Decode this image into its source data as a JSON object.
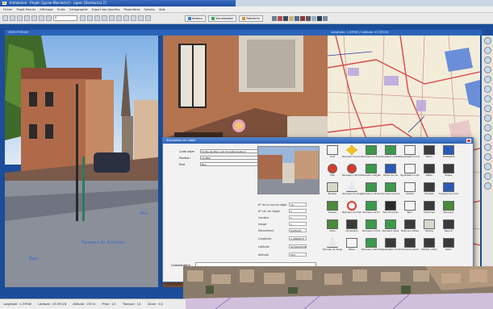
{
  "window": {
    "title": "Immersion - Projet: [Lycee Marrier(s)] - Ligne: [Secteur(s) 2]"
  },
  "menu": [
    "Fichier",
    "Projet Marrier",
    "Affichage",
    "Outils",
    "Cartographie",
    "Export des données",
    "Paramètres",
    "Options",
    "Aide"
  ],
  "toolbar": {
    "field_value": "0",
    "buttons": [
      {
        "label": "Aidesur",
        "icon": "help-icon"
      },
      {
        "label": "Visualisation",
        "icon": "eye-icon"
      },
      {
        "label": "Rafraîchir",
        "icon": "refresh-icon"
      }
    ]
  },
  "panes": {
    "left_title": "VIDÉOTHÈQUE",
    "map_title": "Longitude: 1.3994E / Latitude: 43.5911N"
  },
  "street_labels": [
    "Mur",
    "Panneau de direction",
    "Baie"
  ],
  "status": [
    "Longitude : 1.3994E",
    "Latitude : 43.5911N",
    "Altitude : 153 m",
    "Prise : 1/1",
    "Tranque : 1/1",
    "Zoom : 1/1"
  ],
  "dialog": {
    "title": "Acquisition de l'objet",
    "fields": [
      {
        "label": "Code objet",
        "value": "Sortie de Marc cell (Immatriculation)"
      },
      {
        "label": "Position",
        "value": "15.856"
      },
      {
        "label": "Etat",
        "value": "Bon"
      }
    ],
    "properties": [
      {
        "label": "N° de la couche objet",
        "value": "15"
      },
      {
        "label": "N° réf. de l'objet",
        "value": "1"
      },
      {
        "label": "Caméra",
        "value": "1"
      },
      {
        "label": "Image",
        "value": "1"
      },
      {
        "label": "Mouvement",
        "value": "2325125"
      },
      {
        "label": "Longitude",
        "value": "1.399432 E"
      },
      {
        "label": "Latitude",
        "value": "43.591134 N"
      },
      {
        "label": "Altitude",
        "value": "153"
      }
    ],
    "footer_label": "Commentaire",
    "signs": [
      {
        "label": "Arrêt",
        "icon": "white-sign-icon"
      },
      {
        "label": "Panneaux de priorité",
        "icon": "priority-sign-icon"
      },
      {
        "label": "Panneaux de direction",
        "icon": "green-direction-sign-icon"
      },
      {
        "label": "Panneaux localisation",
        "icon": "green-direction-sign-icon"
      },
      {
        "label": "Signalisation horizontale",
        "icon": "white-sign-icon"
      },
      {
        "label": "Borne",
        "icon": "dark-sign-icon"
      },
      {
        "label": "Candélabre",
        "icon": "bus-sign-icon"
      },
      {
        "label": "Stop",
        "icon": "stop-sign-icon"
      },
      {
        "label": "Panneaux interdiction",
        "icon": "no-entry-sign-icon"
      },
      {
        "label": "Panneaux obligation",
        "icon": "green-direction-sign-icon"
      },
      {
        "label": "Plaque de rue",
        "icon": "blue-sign-icon"
      },
      {
        "label": "Signalisation lumineuse",
        "icon": "white-sign-icon"
      },
      {
        "label": "Balise",
        "icon": "dark-sign-icon"
      },
      {
        "label": "Poteau",
        "icon": "dark-sign-icon"
      },
      {
        "label": "Bouleau",
        "icon": "light-sign-icon"
      },
      {
        "label": "Panneaux de danger",
        "icon": "warning-sign-icon"
      },
      {
        "label": "Panneaux indication",
        "icon": "green-direction-sign-icon"
      },
      {
        "label": "Panneaux service",
        "icon": "green-direction-sign-icon"
      },
      {
        "label": "Caméra",
        "icon": "white-sign-icon"
      },
      {
        "label": "Poubelle",
        "icon": "dark-sign-icon"
      },
      {
        "label": "Transport en commun",
        "icon": "bus-sign-icon"
      },
      {
        "label": "Flaques",
        "icon": "green-sign-icon"
      },
      {
        "label": "Panneaux de limitation",
        "icon": "speed-sign-icon"
      },
      {
        "label": "Panneaux de fin",
        "icon": "green-direction-sign-icon"
      },
      {
        "label": "Feux tricolores",
        "icon": "traffic-light-icon"
      },
      {
        "label": "Banc",
        "icon": "white-sign-icon"
      },
      {
        "label": "Cheminée",
        "icon": "dark-sign-icon"
      },
      {
        "label": "Panneaux",
        "icon": "green-sign-icon"
      },
      {
        "label": "Arbre",
        "icon": "green-sign-icon"
      },
      {
        "label": "Lampadaire",
        "icon": "dark-sign-icon"
      },
      {
        "label": "Panneaux d'infos",
        "icon": "green-direction-sign-icon"
      },
      {
        "label": "Panneaux hauts",
        "icon": "green-direction-sign-icon"
      },
      {
        "label": "Boîte aux lettres",
        "icon": "dark-sign-icon"
      },
      {
        "label": "Parking",
        "icon": "light-sign-icon"
      },
      {
        "label": "Télécom",
        "icon": "dark-sign-icon"
      },
      {
        "label": "Panneau de danger",
        "icon": "warning-sign-icon"
      },
      {
        "label": "Balise",
        "icon": "white-sign-icon"
      },
      {
        "label": "Panneaux intermédiaires",
        "icon": "green-direction-sign-icon"
      },
      {
        "label": "Signalisation horizontale",
        "icon": "dark-sign-icon"
      },
      {
        "label": "Panneaux publics",
        "icon": "dark-sign-icon"
      },
      {
        "label": "Mobilier urbain",
        "icon": "dark-sign-icon"
      },
      {
        "label": "Radar",
        "icon": "dark-sign-icon"
      }
    ]
  },
  "colors": {
    "frame": "#1b4d9a",
    "title_gradient_top": "#4f86d6",
    "map_road_red": "#d94a4a",
    "map_building_purple": "#8c7ac8"
  }
}
